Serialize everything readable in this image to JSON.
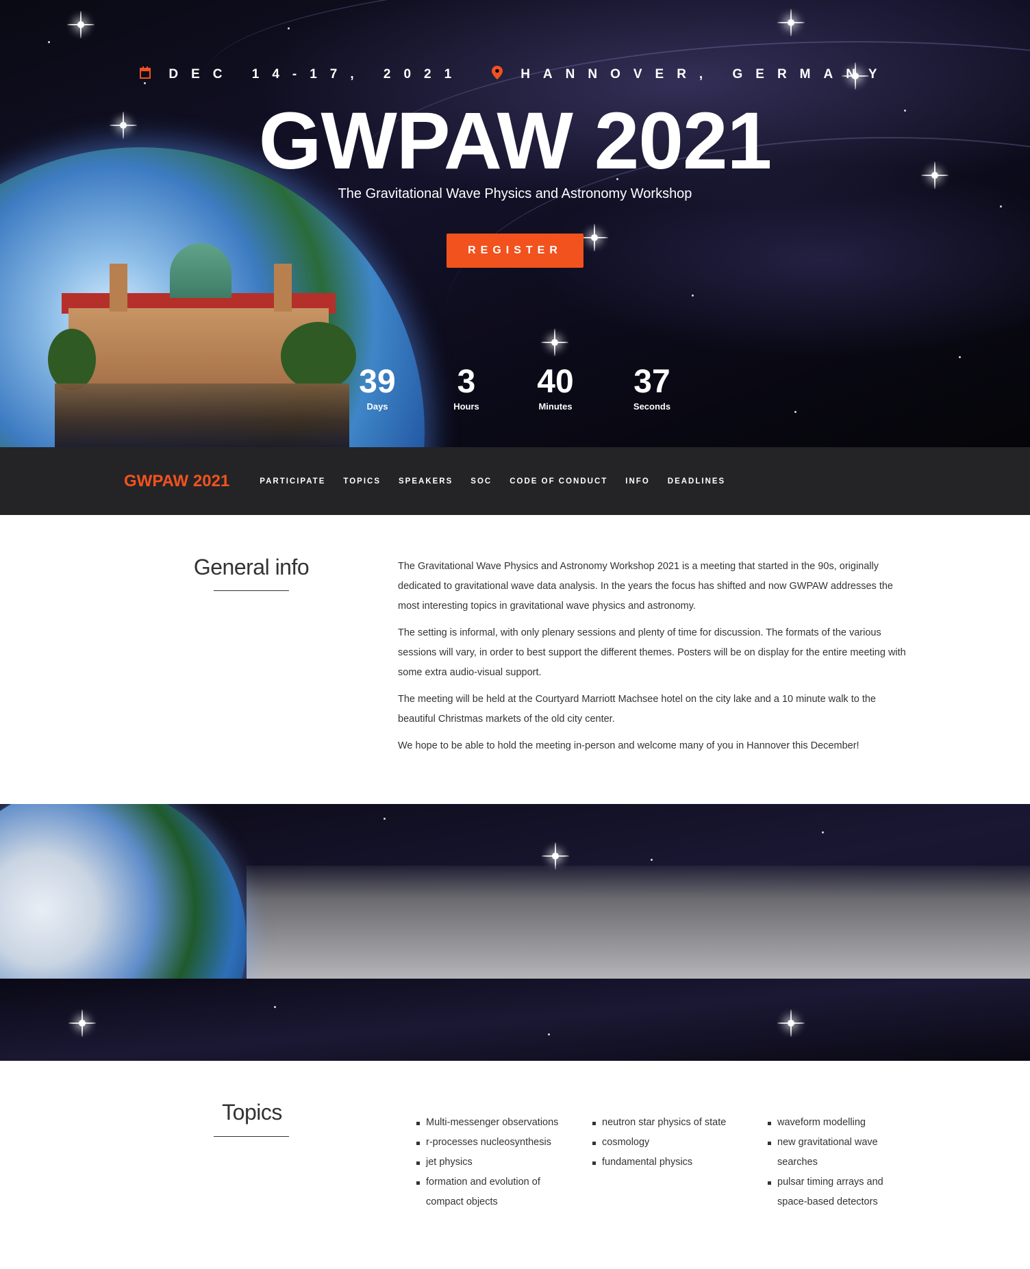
{
  "hero": {
    "date": "DEC 14-17, 2021",
    "location": "HANNOVER, GERMANY",
    "title": "GWPAW 2021",
    "subtitle": "The Gravitational Wave Physics and Astronomy Workshop",
    "register_label": "REGISTER",
    "countdown": [
      {
        "value": "39",
        "label": "Days"
      },
      {
        "value": "3",
        "label": "Hours"
      },
      {
        "value": "40",
        "label": "Minutes"
      },
      {
        "value": "37",
        "label": "Seconds"
      }
    ]
  },
  "nav": {
    "brand": "GWPAW 2021",
    "items": [
      "PARTICIPATE",
      "TOPICS",
      "SPEAKERS",
      "SOC",
      "CODE OF CONDUCT",
      "INFO",
      "DEADLINES"
    ]
  },
  "general": {
    "title": "General info",
    "paragraphs": [
      "The Gravitational Wave Physics and Astronomy Workshop 2021 is a meeting that started in the 90s, originally dedicated to gravitational wave data analysis. In the years the focus has shifted and now GWPAW addresses the most interesting topics in gravitational wave physics and astronomy.",
      "The setting is informal, with only plenary sessions and plenty of time for discussion. The formats of the various sessions will vary, in order to best support the different themes. Posters will be on display for the entire meeting with some extra audio-visual support.",
      "The meeting will be held at the Courtyard Marriott Machsee hotel on the city lake and a 10 minute walk to the beautiful Christmas markets of the old city center.",
      "We hope to be able to hold the meeting in-person and welcome many of you in Hannover this December!"
    ]
  },
  "topics": {
    "title": "Topics",
    "columns": [
      [
        "Multi-messenger observations",
        "r-processes nucleosynthesis",
        "jet physics",
        "formation and evolution of compact objects"
      ],
      [
        "neutron star physics of state",
        "cosmology",
        "fundamental physics"
      ],
      [
        "waveform modelling",
        "new gravitational wave searches",
        "pulsar timing arrays and space-based detectors"
      ]
    ]
  },
  "colors": {
    "accent": "#f2521d",
    "navbar": "#242427"
  },
  "icons": {
    "date": "calendar-icon",
    "location": "map-pin-icon"
  }
}
